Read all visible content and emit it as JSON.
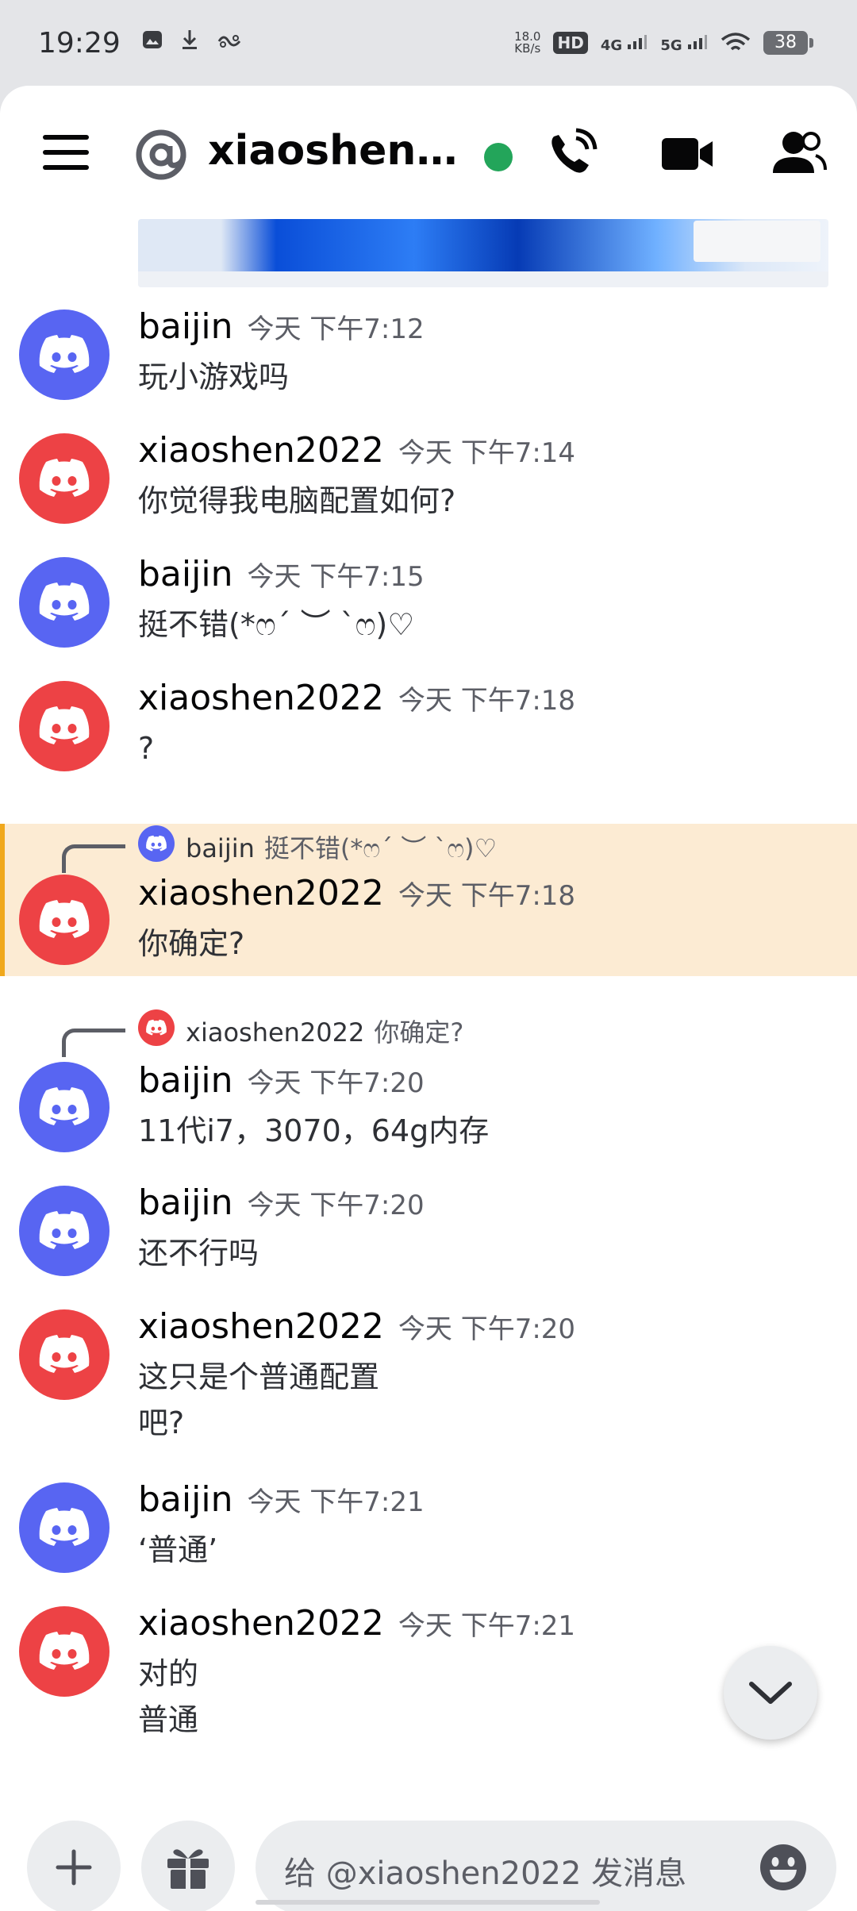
{
  "status_bar": {
    "time": "19:29",
    "net_speed_value": "18.0",
    "net_speed_unit": "KB/s",
    "hd_label": "HD",
    "sim1_label": "4G",
    "sim2_label": "5G",
    "battery": "38"
  },
  "header": {
    "title": "xiaoshen2022",
    "status_color": "#23a55a"
  },
  "colors": {
    "blurple": "#5865f2",
    "red": "#ed4245",
    "highlight_bg": "#fcebd3",
    "highlight_bar": "#f0a81c"
  },
  "messages": [
    {
      "author": "baijin",
      "time": "今天 下午7:12",
      "lines": [
        "玩小游戏吗"
      ],
      "avatar": "blue"
    },
    {
      "author": "xiaoshen2022",
      "time": "今天 下午7:14",
      "lines": [
        "你觉得我电脑配置如何?"
      ],
      "avatar": "red"
    },
    {
      "author": "baijin",
      "time": "今天 下午7:15",
      "lines": [
        "挺不错(*ෆ´ ︶ `ෆ)♡"
      ],
      "avatar": "blue"
    },
    {
      "author": "xiaoshen2022",
      "time": "今天 下午7:18",
      "lines": [
        "?"
      ],
      "avatar": "red"
    },
    {
      "author": "xiaoshen2022",
      "time": "今天 下午7:18",
      "lines": [
        "你确定?"
      ],
      "avatar": "red",
      "reply": {
        "author": "baijin",
        "text": "挺不错(*ෆ´ ︶ `ෆ)♡"
      }
    },
    {
      "author": "baijin",
      "time": "今天 下午7:20",
      "lines": [
        "11代i7，3070，64g内存"
      ],
      "avatar": "blue",
      "reply": {
        "author": "xiaoshen2022",
        "text": "你确定?"
      }
    },
    {
      "author": "baijin",
      "time": "今天 下午7:20",
      "lines": [
        "还不行吗"
      ],
      "avatar": "blue"
    },
    {
      "author": "xiaoshen2022",
      "time": "今天 下午7:20",
      "lines": [
        "这只是个普通配置",
        "吧?"
      ],
      "avatar": "red"
    },
    {
      "author": "baijin",
      "time": "今天 下午7:21",
      "lines": [
        "‘普通’"
      ],
      "avatar": "blue"
    },
    {
      "author": "xiaoshen2022",
      "time": "今天 下午7:21",
      "lines": [
        "对的",
        "普通"
      ],
      "avatar": "red"
    }
  ],
  "composer": {
    "placeholder": "给 @xiaoshen2022 发消息"
  }
}
